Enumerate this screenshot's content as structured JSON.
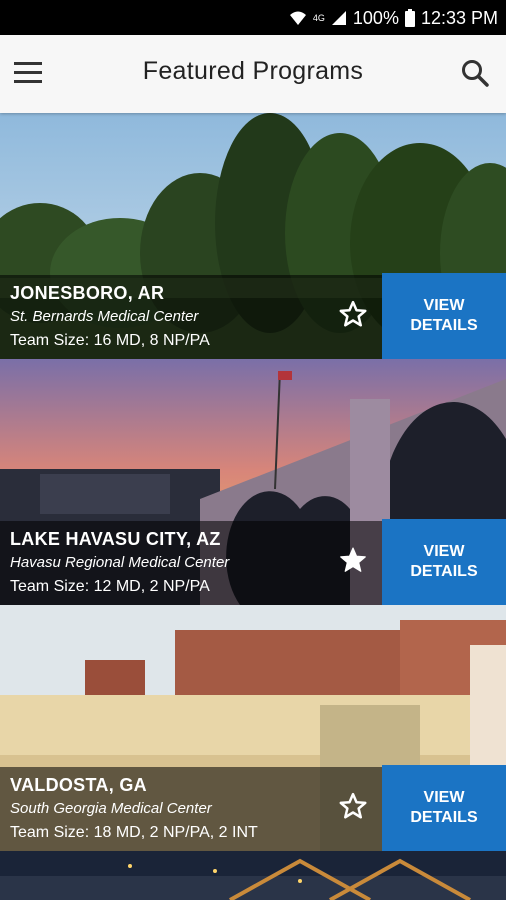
{
  "status": {
    "battery": "100%",
    "time": "12:33 PM",
    "network": "4G"
  },
  "header": {
    "title": "Featured Programs",
    "menu_icon": "hamburger-menu-icon",
    "search_icon": "search-icon"
  },
  "programs": [
    {
      "city": "JONESBORO, AR",
      "hospital": "St. Bernards Medical Center",
      "team": "Team Size: 16 MD, 8 NP/PA",
      "favorite": false,
      "button_line1": "VIEW",
      "button_line2": "DETAILS"
    },
    {
      "city": "LAKE HAVASU CITY, AZ",
      "hospital": "Havasu Regional Medical Center",
      "team": "Team Size: 12 MD, 2 NP/PA",
      "favorite": true,
      "button_line1": "VIEW",
      "button_line2": "DETAILS"
    },
    {
      "city": "VALDOSTA, GA",
      "hospital": "South Georgia Medical Center",
      "team": "Team Size: 18 MD, 2 NP/PA, 2 INT",
      "favorite": false,
      "button_line1": "VIEW",
      "button_line2": "DETAILS"
    }
  ],
  "colors": {
    "accent": "#1b74c4",
    "appbar": "#f7f7f7"
  }
}
